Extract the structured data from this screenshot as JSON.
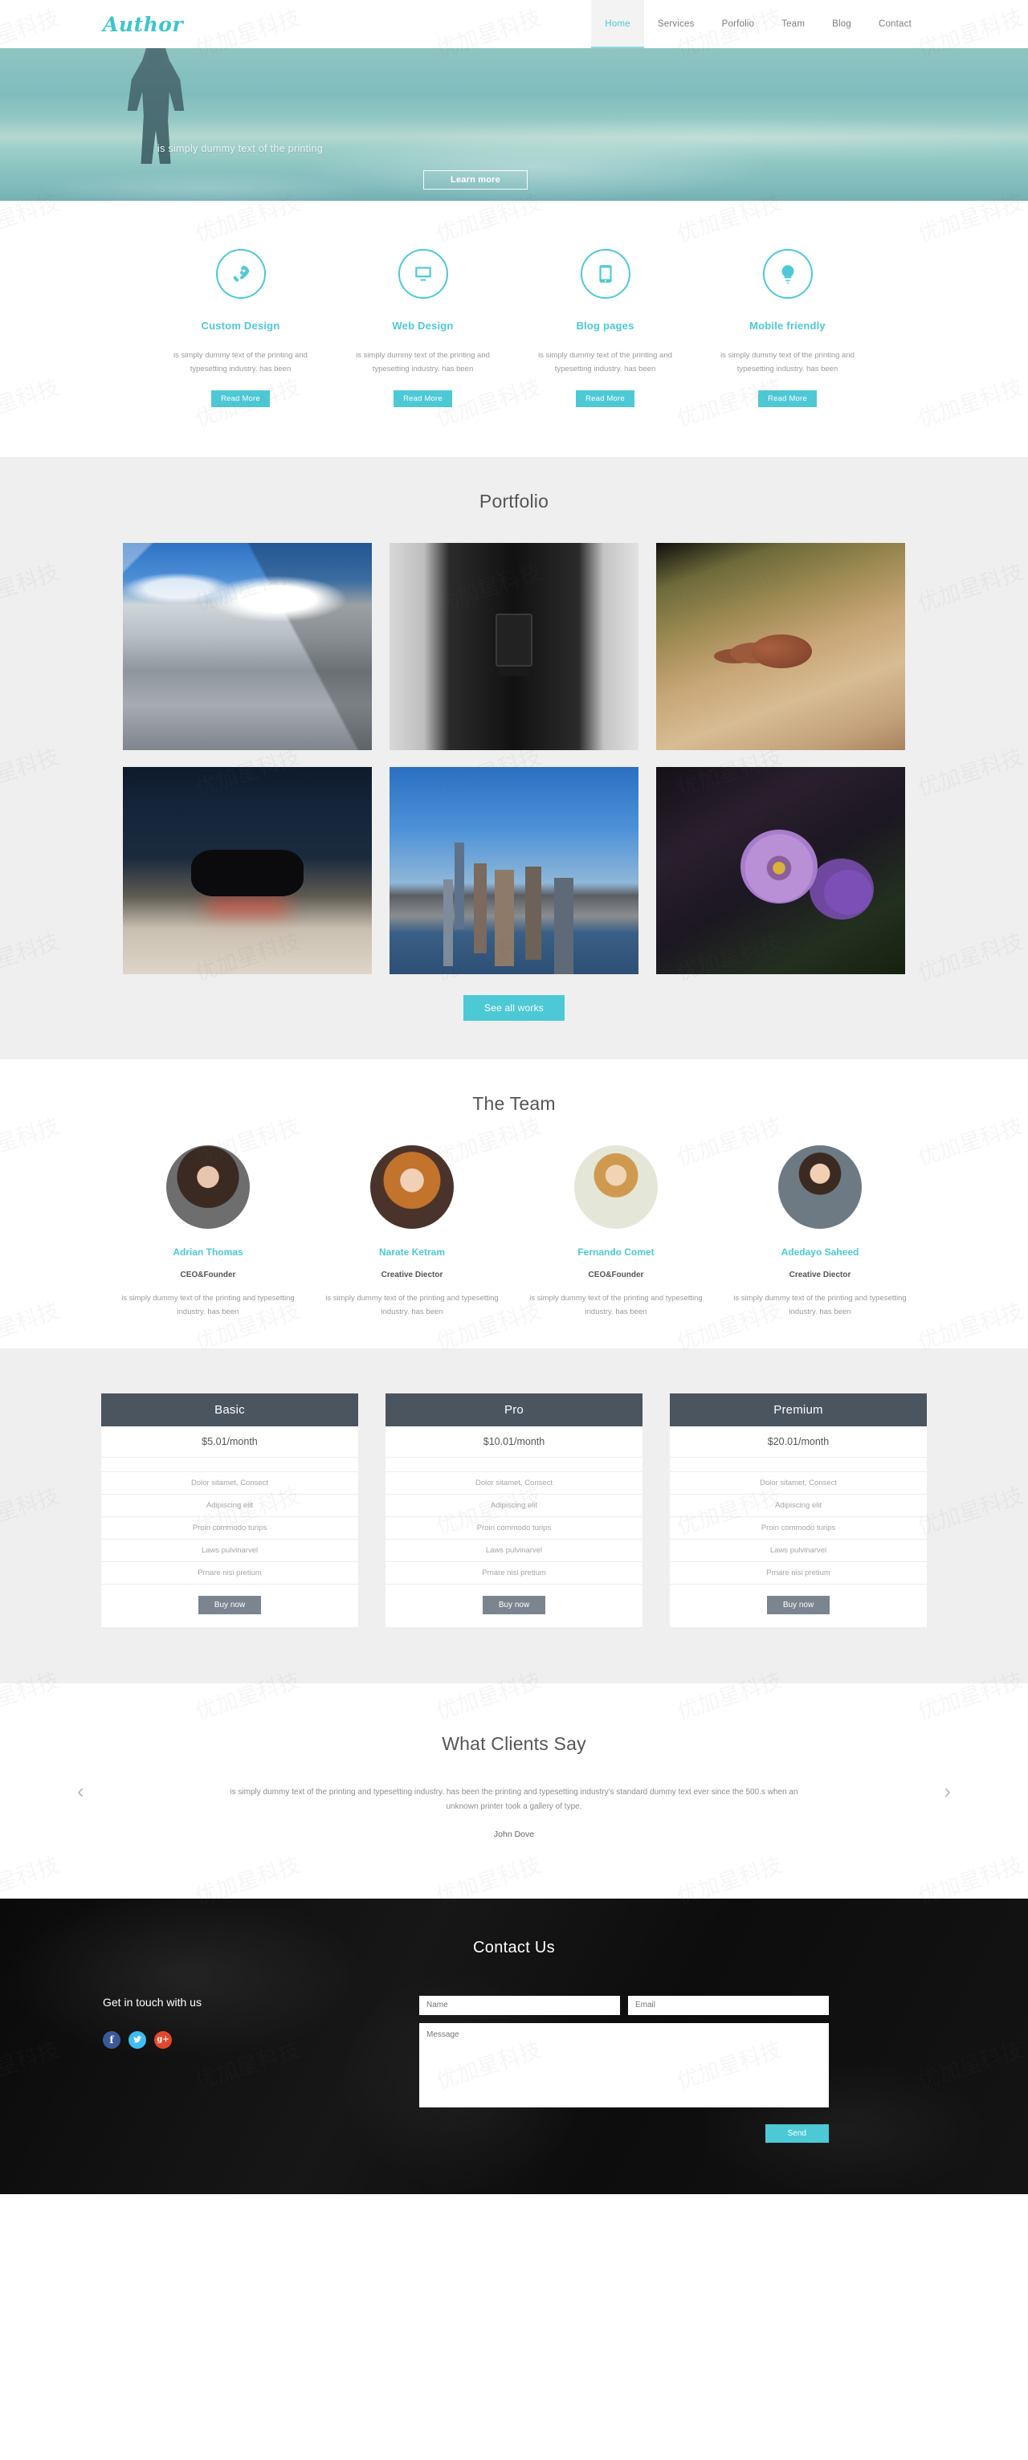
{
  "header": {
    "brand": "Author",
    "nav": [
      {
        "label": "Home",
        "active": true
      },
      {
        "label": "Services",
        "active": false
      },
      {
        "label": "Porfolio",
        "active": false
      },
      {
        "label": "Team",
        "active": false
      },
      {
        "label": "Blog",
        "active": false
      },
      {
        "label": "Contact",
        "active": false
      }
    ]
  },
  "hero": {
    "text": "is simply dummy text of the printing",
    "button": "Learn more"
  },
  "services": {
    "items": [
      {
        "icon": "rocket-icon",
        "title": "Custom Design",
        "desc": "is simply dummy text of the printing and typesetting industry. has been",
        "button": "Read More"
      },
      {
        "icon": "monitor-icon",
        "title": "Web Design",
        "desc": "is simply dummy text of the printing and typesetting industry. has been",
        "button": "Read More"
      },
      {
        "icon": "mobile-icon",
        "title": "Blog pages",
        "desc": "is simply dummy text of the printing and typesetting industry. has been",
        "button": "Read More"
      },
      {
        "icon": "lightbulb-icon",
        "title": "Mobile friendly",
        "desc": "is simply dummy text of the printing and typesetting industry. has been",
        "button": "Read More"
      }
    ]
  },
  "portfolio": {
    "title": "Portfolio",
    "items": [
      {
        "name": "snowy-mountains"
      },
      {
        "name": "photographer-black-and-white"
      },
      {
        "name": "acorns-on-leaf"
      },
      {
        "name": "game-controller"
      },
      {
        "name": "city-skyline"
      },
      {
        "name": "purple-flowers"
      }
    ],
    "see_all_button": "See all works"
  },
  "team": {
    "title": "The Team",
    "members": [
      {
        "name": "Adrian Thomas",
        "role": "CEO&Founder",
        "desc": "is simply dummy text of the printing and typesetting industry. has been"
      },
      {
        "name": "Narate Ketram",
        "role": "Creative Diector",
        "desc": "is simply dummy text of the printing and typesetting industry. has been"
      },
      {
        "name": "Fernando Comet",
        "role": "CEO&Founder",
        "desc": "is simply dummy text of the printing and typesetting industry. has been"
      },
      {
        "name": "Adedayo Saheed",
        "role": "Creative Diector",
        "desc": "is simply dummy text of the printing and typesetting industry. has been"
      }
    ]
  },
  "pricing": {
    "plans": [
      {
        "name": "Basic",
        "price": "$5.01/month",
        "features": [
          "Dolor sitamet, Consect",
          "Adipiscing elit",
          "Proin commodo turips",
          "Laws pulvinarvel",
          "Prnare nisi pretium"
        ],
        "button": "Buy now"
      },
      {
        "name": "Pro",
        "price": "$10.01/month",
        "features": [
          "Dolor sitamet, Consect",
          "Adipiscing elit",
          "Proin commodo turips",
          "Laws pulvinarvel",
          "Prnare nisi pretium"
        ],
        "button": "Buy now"
      },
      {
        "name": "Premium",
        "price": "$20.01/month",
        "features": [
          "Dolor sitamet, Consect",
          "Adipiscing elit",
          "Proin commodo turips",
          "Laws pulvinarvel",
          "Prnare nisi pretium"
        ],
        "button": "Buy now"
      }
    ]
  },
  "testimonials": {
    "title": "What Clients Say",
    "quote": "is simply dummy text of the printing and typesetting industry. has been the printing and typesetting industry's standard dummy text ever since the 500.s when an unknown printer took a gallery of type.",
    "author": "John Dove",
    "prev_icon": "‹",
    "next_icon": "›"
  },
  "contact": {
    "title": "Contact Us",
    "get_in_touch": "Get in touch with us",
    "socials": [
      {
        "name": "facebook-icon",
        "glyph": "f",
        "color": "#3b5998"
      },
      {
        "name": "twitter-icon",
        "glyph": "ᵛ",
        "color": "#3fbdf1"
      },
      {
        "name": "google-plus-icon",
        "glyph": "g+",
        "color": "#e2482e"
      }
    ],
    "form": {
      "name_placeholder": "Name",
      "email_placeholder": "Email",
      "message_placeholder": "Message",
      "send_button": "Send"
    }
  },
  "theme": {
    "accent": "#4dc9d6",
    "dark": "#4a5560",
    "grey_button": "#7b858f",
    "section_bg": "#efefef"
  },
  "watermark": {
    "text": "优加星科技"
  }
}
